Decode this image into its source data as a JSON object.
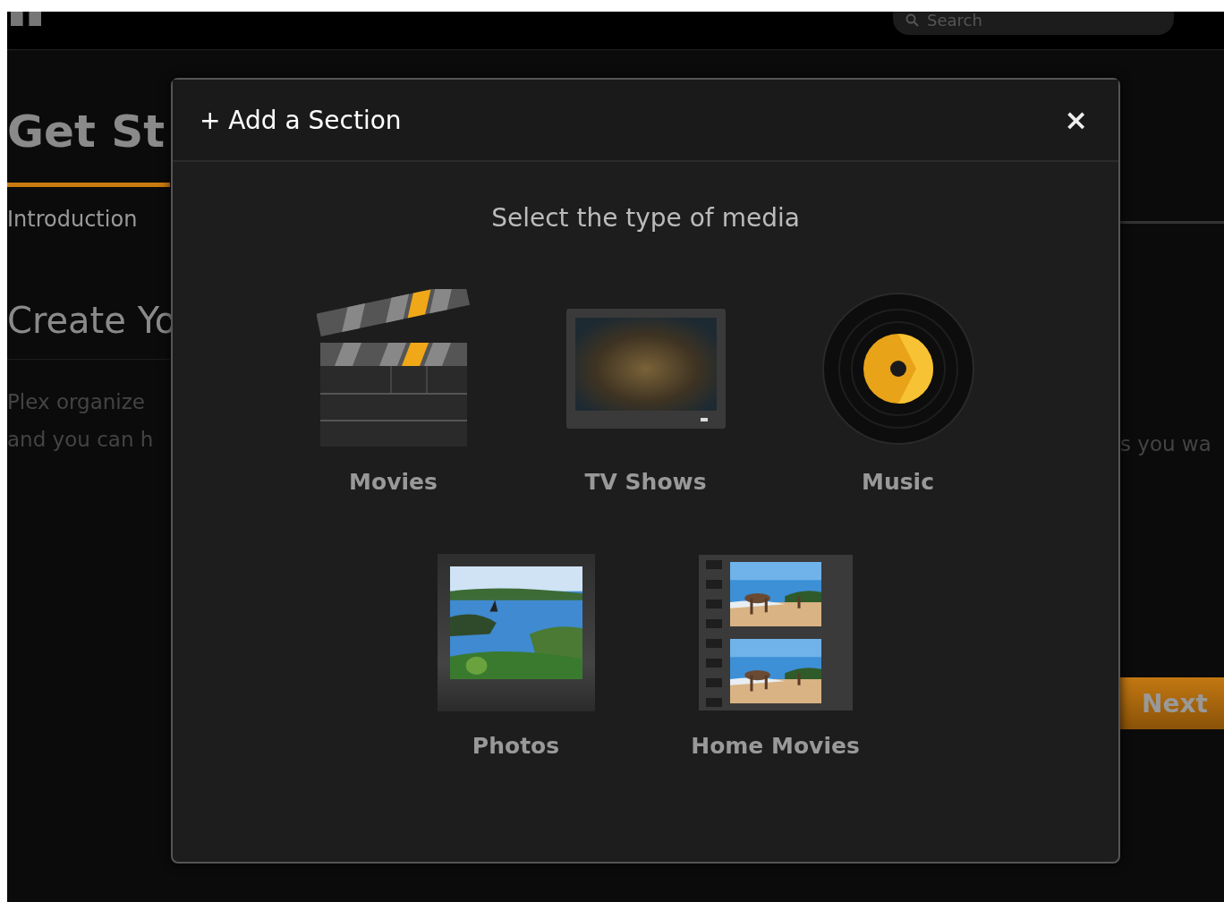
{
  "top_bar": {
    "search": {
      "placeholder": "Search"
    }
  },
  "background_page": {
    "heading": "Get St",
    "progress": {
      "level": 1
    },
    "step": "Introduction",
    "subheading": "Create Yo",
    "paragraph_left": [
      "Plex organize",
      "and you can h"
    ],
    "paragraph_right": "s you wa",
    "next_button": "Next"
  },
  "dialog": {
    "title": "+ Add a Section",
    "close": "×",
    "prompt": "Select the type of media",
    "rows": [
      [
        {
          "label": "Movies",
          "kind": "movies"
        },
        {
          "label": "TV Shows",
          "kind": "tv"
        },
        {
          "label": "Music",
          "kind": "music"
        }
      ],
      [
        {
          "label": "Photos",
          "kind": "photos"
        },
        {
          "label": "Home Movies",
          "kind": "home_movies"
        }
      ]
    ]
  }
}
